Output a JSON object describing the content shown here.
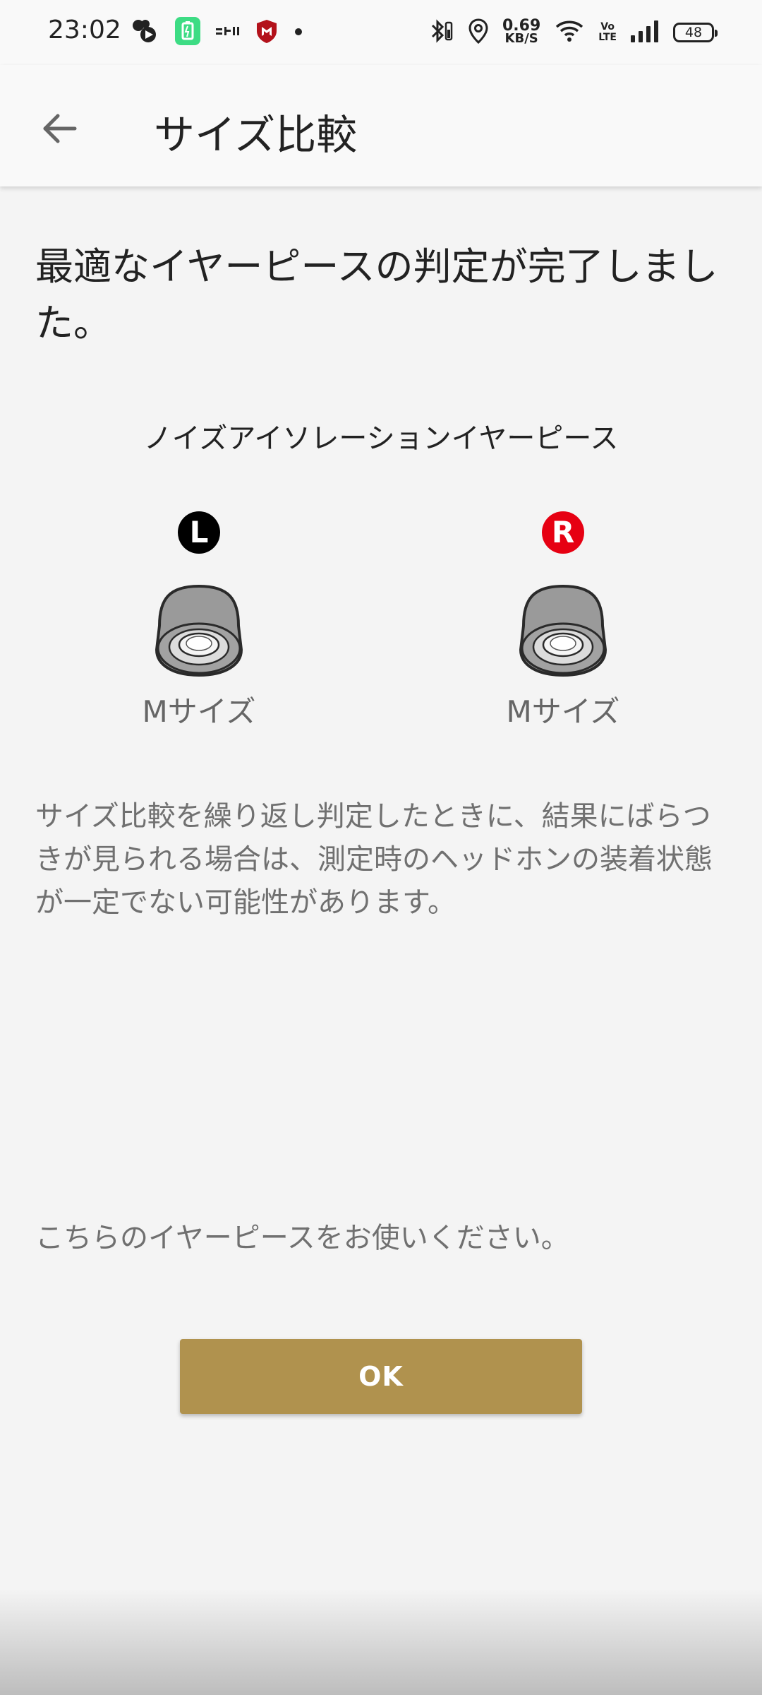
{
  "status_bar": {
    "time": "23:02",
    "net_speed_value": "0.69",
    "net_speed_unit": "KB/S",
    "volte_top": "Vo",
    "volte_bottom": "LTE",
    "battery_level": "48",
    "left_icons": [
      "media-playback-icon",
      "battery-saver-icon",
      "app-notification-icon",
      "mcafee-icon",
      "more-dot-icon"
    ],
    "right_icons": [
      "bluetooth-icon",
      "location-icon",
      "wifi-icon",
      "cellular-signal-icon",
      "battery-icon"
    ]
  },
  "app_bar": {
    "title": "サイズ比較",
    "back_icon": "arrow-left-icon"
  },
  "main": {
    "heading": "最適なイヤーピースの判定が完了しました。",
    "earpiece_type": "ノイズアイソレーションイヤーピース",
    "left": {
      "badge": "L",
      "badge_color": "#000000",
      "size": "Mサイズ"
    },
    "right": {
      "badge": "R",
      "badge_color": "#e60012",
      "size": "Mサイズ"
    },
    "note": "サイズ比較を繰り返し判定したときに、結果にばらつきが見られる場合は、測定時のヘッドホンの装着状態が一定でない可能性があります。",
    "instruction": "こちらのイヤーピースをお使いください。",
    "ok_label": "OK"
  },
  "colors": {
    "accent": "#b0924e",
    "background": "#f4f4f4",
    "app_bar": "#f9f9f9"
  }
}
